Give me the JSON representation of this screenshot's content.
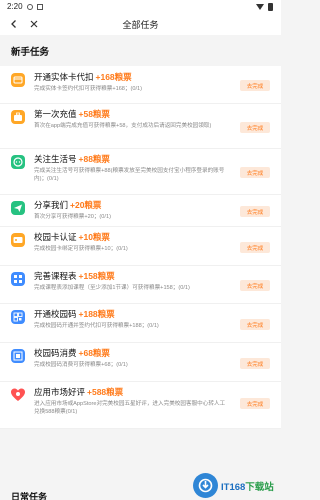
{
  "statusbar": {
    "time": "2:20"
  },
  "header": {
    "title": "全部任务"
  },
  "sections": {
    "novice": "新手任务",
    "daily": "日常任务"
  },
  "tasks": [
    {
      "title": "开通实体卡代扣",
      "reward": "+168粮票",
      "desc": "完成实体卡签约代扣可获得粮票+168；(0/1)",
      "button": "去完成",
      "icon": "card-icon",
      "color": "#ffa726"
    },
    {
      "title": "第一次充值",
      "reward": "+58粮票",
      "desc": "首次在app端完成充值可获得粮票+58，支付成功后请返回完美校园領取)",
      "button": "去完成",
      "icon": "briefcase-icon",
      "color": "#ffa726"
    },
    {
      "title": "关注生活号",
      "reward": "+88粮票",
      "desc": "完成关注生活号可获得粮票+88(粮票发放至完美校园支付宝小程序登录的账号内)；(0/1)",
      "button": "去完成",
      "icon": "chat-icon",
      "color": "#26c281"
    },
    {
      "title": "分享我们",
      "reward": "+20粮票",
      "desc": "首次分享可获得粮票+20；(0/1)",
      "button": "去完成",
      "icon": "send-icon",
      "color": "#26c281"
    },
    {
      "title": "校园卡认证",
      "reward": "+10粮票",
      "desc": "完成校园卡绑定可获得粮票+10；(0/1)",
      "button": "去完成",
      "icon": "idcard-icon",
      "color": "#ffa726"
    },
    {
      "title": "完善课程表",
      "reward": "+158粮票",
      "desc": "完成课程表添加课程（至少添加1节课）可获得粮票+158；(0/1)",
      "button": "去完成",
      "icon": "grid-icon",
      "color": "#3f8cff"
    },
    {
      "title": "开通校园码",
      "reward": "+188粮票",
      "desc": "完成校园码开通并签约代扣可获得粮票+188；(0/1)",
      "button": "去完成",
      "icon": "qrcode-icon",
      "color": "#3f8cff"
    },
    {
      "title": "校园码消费",
      "reward": "+68粮票",
      "desc": "完成校园码消费可获得粮票+68；(0/1)",
      "button": "去完成",
      "icon": "qrcode-pay-icon",
      "color": "#3f8cff"
    },
    {
      "title": "应用市场好评",
      "reward": "+588粮票",
      "desc": "进入应用市场或AppStore对完美校园五星好评，进入完美校园客服中心转人工兑换588粮票(0/1)",
      "button": "去完成",
      "icon": "heart-icon",
      "color": "#ff5252"
    }
  ],
  "watermark": {
    "brand": "IT168",
    "suffix": "下载站"
  }
}
